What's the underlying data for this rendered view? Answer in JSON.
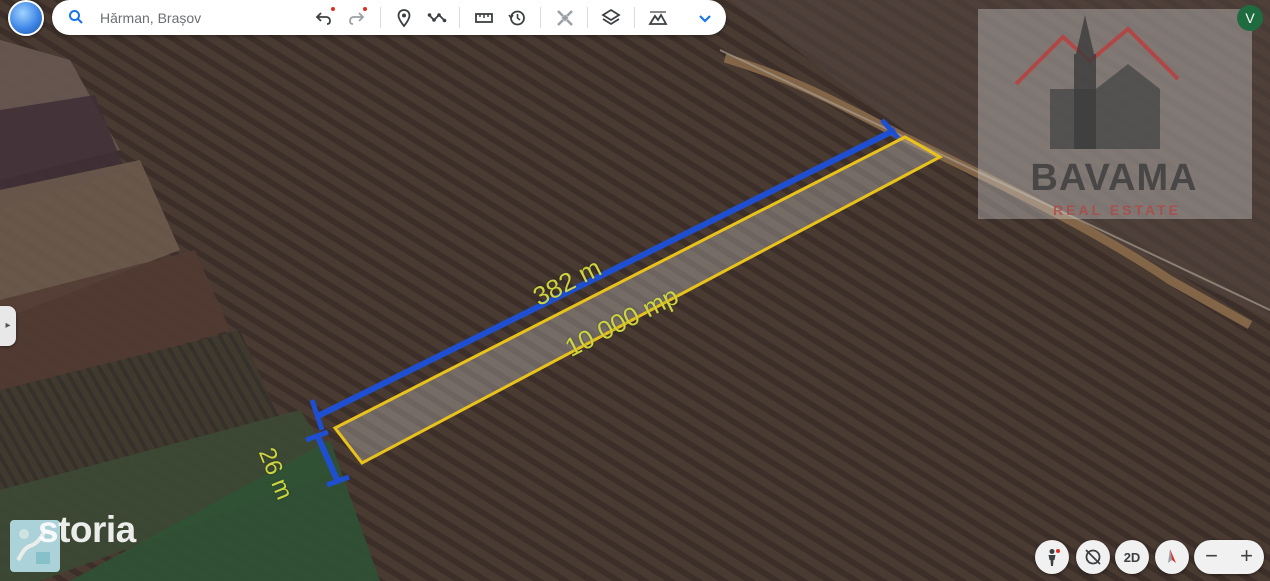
{
  "search": {
    "placeholder": "Hărman, Brașov"
  },
  "toolbar": {
    "tools": [
      {
        "name": "undo-icon"
      },
      {
        "name": "redo-icon"
      },
      {
        "name": "placemark-icon"
      },
      {
        "name": "path-icon"
      },
      {
        "name": "ruler-icon"
      },
      {
        "name": "history-icon"
      },
      {
        "name": "satellite-icon"
      },
      {
        "name": "layers-icon"
      },
      {
        "name": "terrain-icon"
      },
      {
        "name": "chevron-down-icon"
      }
    ]
  },
  "user": {
    "initial": "V"
  },
  "watermark": {
    "name": "BAVAMA",
    "subtitle": "REAL ESTATE"
  },
  "annotations": {
    "length": "382 m",
    "area": "10 000 mp",
    "width": "26 m"
  },
  "brand": {
    "name": "storia"
  },
  "controls": {
    "view_mode": "2D",
    "zoom_out": "−",
    "zoom_in": "+"
  },
  "colors": {
    "length_line": "#1f4fd1",
    "parcel_outline": "#e9c21c",
    "label_text": "#ccd53f",
    "brand_badge": "#b7e2ea",
    "avatar": "#1e6b3f"
  }
}
